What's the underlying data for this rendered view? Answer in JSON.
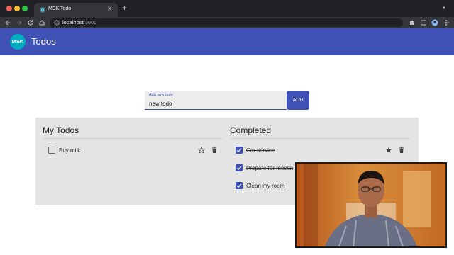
{
  "browser": {
    "tab": {
      "title": "MSK Todo"
    },
    "url": {
      "host": "localhost",
      "port": ":3000"
    }
  },
  "app": {
    "logo_text": "MSK",
    "title": "Todos",
    "colors": {
      "primary": "#3f51b5",
      "logo": "#00acc1",
      "panel": "#e4e4e4"
    }
  },
  "add_form": {
    "label": "Add new todo",
    "value": "new todo",
    "button_label": "ADD"
  },
  "my_todos": {
    "title": "My Todos",
    "items": [
      {
        "label": "Buy milk",
        "checked": false,
        "starred": false
      }
    ]
  },
  "completed": {
    "title": "Completed",
    "items": [
      {
        "label": "Car service",
        "checked": true,
        "starred": true
      },
      {
        "label": "Prepare for meetin",
        "checked": true
      },
      {
        "label": "Clean my room",
        "checked": true
      }
    ]
  },
  "icons": {
    "star_outline": "star-outline-icon",
    "star_filled": "star-filled-icon",
    "delete": "trash-icon"
  }
}
